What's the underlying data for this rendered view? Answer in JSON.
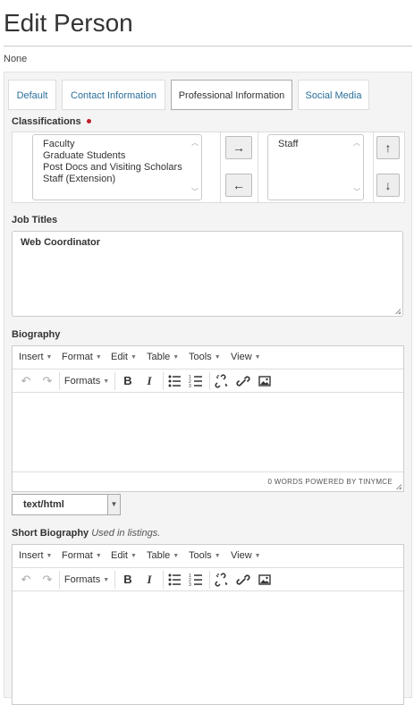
{
  "page": {
    "title": "Edit Person",
    "none_text": "None"
  },
  "tabs": [
    {
      "label": "Default"
    },
    {
      "label": "Contact Information"
    },
    {
      "label": "Professional Information",
      "active": true
    },
    {
      "label": "Social Media"
    }
  ],
  "classifications": {
    "label": "Classifications",
    "available": [
      "Faculty",
      "Graduate Students",
      "Post Docs and Visiting Scholars",
      "Staff (Extension)"
    ],
    "selected": [
      "Staff"
    ],
    "move_right": "→",
    "move_left": "←",
    "move_up": "↑",
    "move_down": "↓",
    "required_color": "#c0202a"
  },
  "job_titles": {
    "label": "Job Titles",
    "value": "Web Coordinator"
  },
  "biography": {
    "label": "Biography",
    "menu": [
      "Insert",
      "Format",
      "Edit",
      "Table",
      "Tools",
      "View"
    ],
    "formats_label": "Formats",
    "toolbar_icons": [
      "undo-icon",
      "redo-icon",
      "bold-icon",
      "italic-icon",
      "bullet-list-icon",
      "numbered-list-icon",
      "unlink-icon",
      "link-icon",
      "image-icon"
    ],
    "status": "0 WORDS POWERED BY TINYMCE",
    "format_select": "text/html"
  },
  "short_biography": {
    "label": "Short Biography",
    "hint": "Used in listings.",
    "menu": [
      "Insert",
      "Format",
      "Edit",
      "Table",
      "Tools",
      "View"
    ],
    "formats_label": "Formats"
  },
  "colors": {
    "link": "#2a6f9a",
    "panel": "#f4f4f4"
  }
}
